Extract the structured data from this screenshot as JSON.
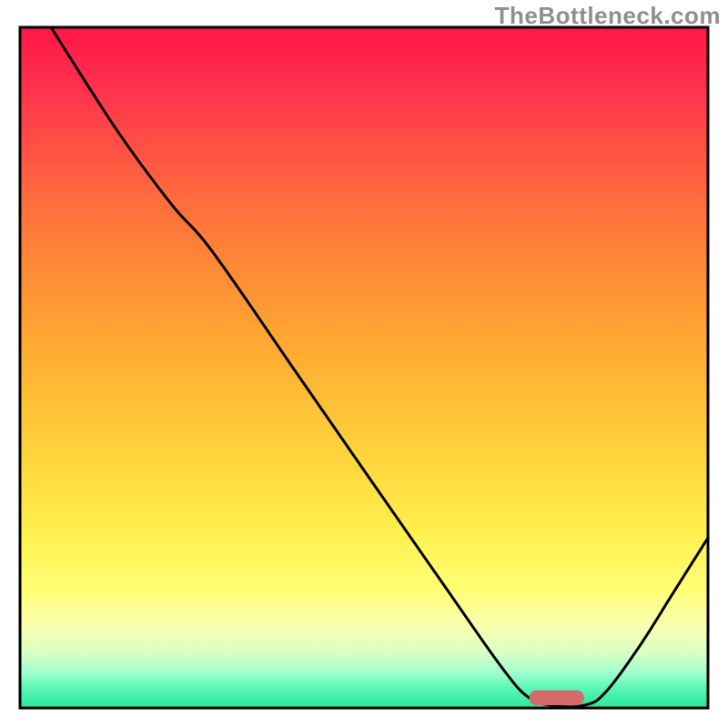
{
  "watermark": "TheBottleneck.com",
  "chart_data": {
    "type": "line",
    "title": "",
    "xlabel": "",
    "ylabel": "",
    "xlim": [
      0,
      100
    ],
    "ylim": [
      0,
      100
    ],
    "gradient_stops": [
      {
        "offset": 0,
        "color": "#ff1744"
      },
      {
        "offset": 8,
        "color": "#ff2e4e"
      },
      {
        "offset": 25,
        "color": "#ff6b3d"
      },
      {
        "offset": 45,
        "color": "#ffa531"
      },
      {
        "offset": 62,
        "color": "#ffd23a"
      },
      {
        "offset": 75,
        "color": "#fff250"
      },
      {
        "offset": 83,
        "color": "#ffff78"
      },
      {
        "offset": 88,
        "color": "#faffb0"
      },
      {
        "offset": 92,
        "color": "#d8ffc4"
      },
      {
        "offset": 95,
        "color": "#9bffcd"
      },
      {
        "offset": 97,
        "color": "#5cf7b7"
      },
      {
        "offset": 100,
        "color": "#28e79a"
      }
    ],
    "series": [
      {
        "name": "bottleneck-curve",
        "points": [
          {
            "x": 4.5,
            "y": 100
          },
          {
            "x": 14,
            "y": 85
          },
          {
            "x": 22,
            "y": 74
          },
          {
            "x": 28,
            "y": 67
          },
          {
            "x": 40,
            "y": 49.5
          },
          {
            "x": 52,
            "y": 32
          },
          {
            "x": 62,
            "y": 17.5
          },
          {
            "x": 70,
            "y": 6
          },
          {
            "x": 74,
            "y": 1.5
          },
          {
            "x": 78,
            "y": 0.3
          },
          {
            "x": 82,
            "y": 0.4
          },
          {
            "x": 85,
            "y": 2.2
          },
          {
            "x": 90,
            "y": 9
          },
          {
            "x": 95,
            "y": 17
          },
          {
            "x": 100,
            "y": 25
          }
        ]
      }
    ],
    "marker": {
      "x_center": 78,
      "y": 1.5,
      "width": 8,
      "height": 2.2,
      "color": "#d46a6a"
    },
    "frame": {
      "color": "#000000",
      "width": 3
    }
  }
}
